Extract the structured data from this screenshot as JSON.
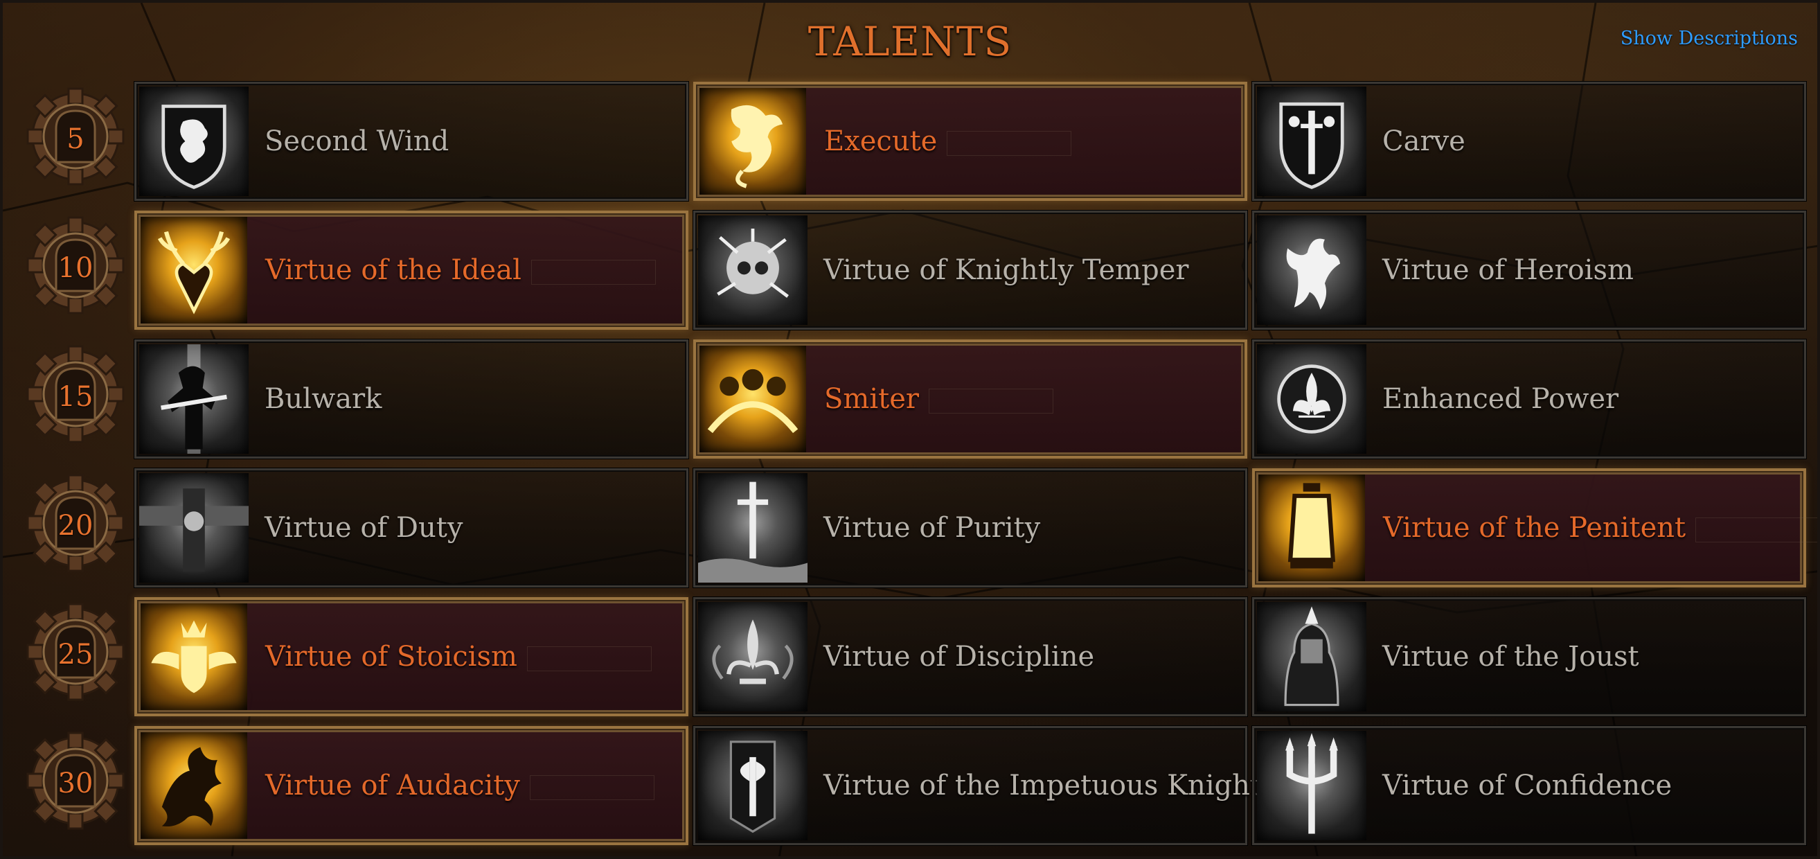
{
  "header": {
    "title": "TALENTS",
    "show_descriptions": "Show Descriptions"
  },
  "colors": {
    "title": "#e0702c",
    "selected_label": "#e4692a",
    "unselected_label": "#b7b2aa",
    "link": "#2f9dff",
    "selected_border": "#9a7440"
  },
  "rows": [
    {
      "level": "5",
      "talents": [
        {
          "label": "Second Wind",
          "icon": "lion-shield-icon",
          "selected": false
        },
        {
          "label": "Execute",
          "icon": "dragon-icon",
          "selected": true
        },
        {
          "label": "Carve",
          "icon": "fleur-sword-shield-icon",
          "selected": false
        }
      ]
    },
    {
      "level": "10",
      "talents": [
        {
          "label": "Virtue of the Ideal",
          "icon": "stag-head-icon",
          "selected": true
        },
        {
          "label": "Virtue of Knightly Temper",
          "icon": "shattered-skull-icon",
          "selected": false
        },
        {
          "label": "Virtue of Heroism",
          "icon": "griffin-icon",
          "selected": false
        }
      ]
    },
    {
      "level": "15",
      "talents": [
        {
          "label": "Bulwark",
          "icon": "warrior-silhouette-icon",
          "selected": false
        },
        {
          "label": "Smiter",
          "icon": "smiting-hooded-figures-icon",
          "selected": true
        },
        {
          "label": "Enhanced Power",
          "icon": "fleur-de-lis-orb-icon",
          "selected": false
        }
      ]
    },
    {
      "level": "20",
      "talents": [
        {
          "label": "Virtue of Duty",
          "icon": "banner-cross-icon",
          "selected": false
        },
        {
          "label": "Virtue of Purity",
          "icon": "sword-in-water-icon",
          "selected": false
        },
        {
          "label": "Virtue of the Penitent",
          "icon": "lantern-icon",
          "selected": true
        }
      ]
    },
    {
      "level": "25",
      "talents": [
        {
          "label": "Virtue of Stoicism",
          "icon": "crowned-winged-shield-icon",
          "selected": true
        },
        {
          "label": "Virtue of Discipline",
          "icon": "winged-fleur-icon",
          "selected": false
        },
        {
          "label": "Virtue of the Joust",
          "icon": "knight-helm-icon",
          "selected": false
        }
      ]
    },
    {
      "level": "30",
      "talents": [
        {
          "label": "Virtue of Audacity",
          "icon": "wyvern-icon",
          "selected": true
        },
        {
          "label": "Virtue of the Impetuous Knight",
          "icon": "axe-banner-icon",
          "selected": false
        },
        {
          "label": "Virtue of Confidence",
          "icon": "trident-icon",
          "selected": false
        }
      ]
    }
  ]
}
